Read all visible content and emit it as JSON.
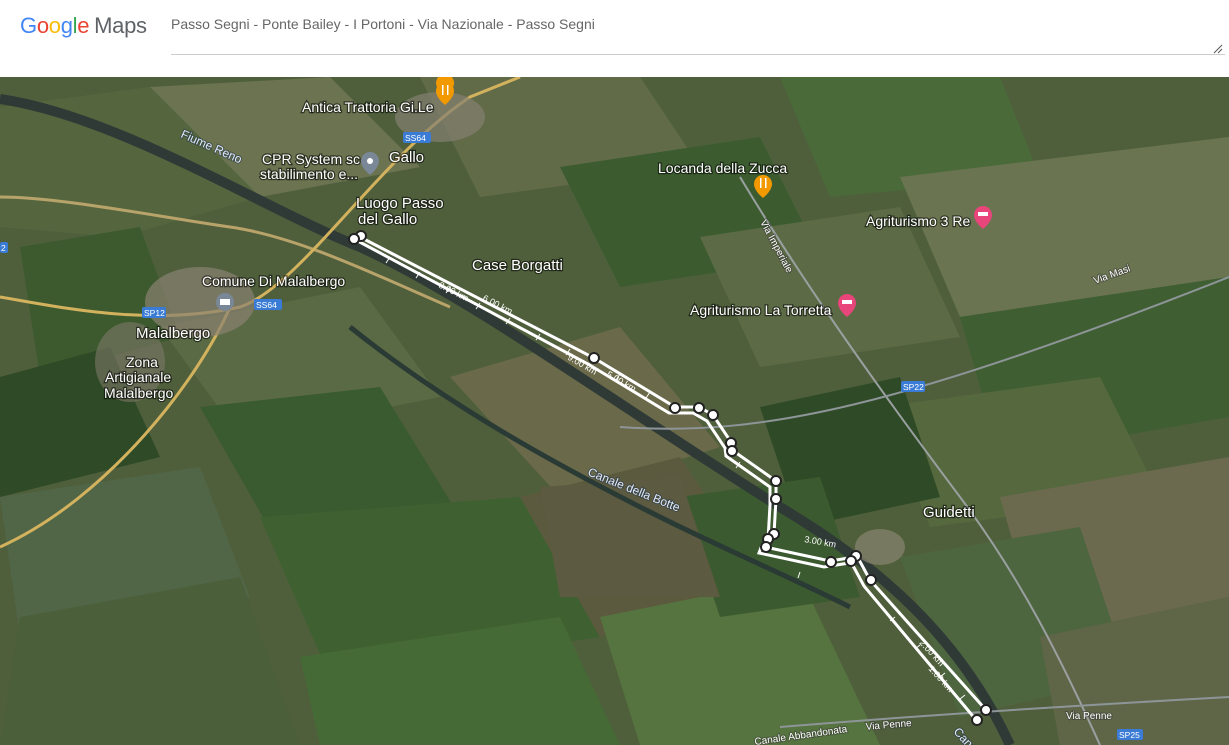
{
  "header": {
    "logo": {
      "google": "Google",
      "maps": "Maps"
    },
    "route_title": "Passo Segni - Ponte Bailey - I Portoni - Via Nazionale - Passo Segni"
  },
  "map": {
    "type": "satellite",
    "colors": {
      "route": "#ffffff",
      "food_pin": "#f29900",
      "hotel_pin": "#e8457a",
      "place_pin": "#7a8797",
      "shield": "#3a7bd5"
    },
    "places": [
      {
        "name": "Gallo"
      },
      {
        "name": "Luogo Passo",
        "name2": "del Gallo"
      },
      {
        "name": "Case Borgatti"
      },
      {
        "name": "Malalbergo"
      },
      {
        "name": "Zona",
        "name2": "Artigianale",
        "name3": "Malalbergo"
      },
      {
        "name": "Guidetti"
      },
      {
        "name": "Comune Di Malalbergo"
      },
      {
        "name": "CPR System sc",
        "name2": "stabilimento e..."
      }
    ],
    "pois": [
      {
        "name": "Antica Trattoria Gi.Le",
        "icon": "restaurant-icon"
      },
      {
        "name": "Locanda della Zucca",
        "icon": "restaurant-icon"
      },
      {
        "name": "Agriturismo 3 Re",
        "icon": "hotel-icon"
      },
      {
        "name": "Agriturismo La Torretta",
        "icon": "hotel-icon"
      }
    ],
    "water": [
      {
        "name": "Fiume Reno"
      },
      {
        "name": "Canale della Botte"
      },
      {
        "name": "Canale"
      }
    ],
    "roads": [
      {
        "name": "Via Imperiale"
      },
      {
        "name": "Via Masi"
      },
      {
        "name": "Via Penne"
      },
      {
        "name": "Canale Abbandonata"
      }
    ],
    "shields": [
      "SS64",
      "SS64",
      "SP12",
      "SP22",
      "SP25",
      "2"
    ],
    "distance_labels": [
      "8.00 km",
      "6.00 km",
      "9.00 km",
      "5.00 km",
      "3.00 km",
      "2.00 km",
      "1.00 km"
    ]
  }
}
